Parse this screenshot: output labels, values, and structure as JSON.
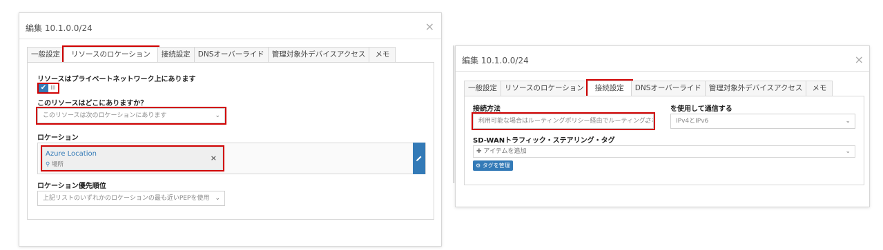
{
  "dialog1": {
    "title": "編集 10.1.0.0/24",
    "close": "×",
    "tabs": [
      "一般設定",
      "リソースのロケーション",
      "接続設定",
      "DNSオーバーライド",
      "管理対象外デバイスアクセス",
      "メモ"
    ],
    "private_label": "リソースはプライベートネットワーク上にあります",
    "toggle_on": "✔",
    "toggle_off": "III",
    "where_label": "このリソースはどこにありますか？",
    "where_value": "このリソースは次のロケーションにあります",
    "location_label": "ロケーション",
    "location_name": "Azure Location",
    "location_sub_icon": "⚲",
    "location_sub": "場所",
    "location_remove": "×",
    "edit_icon": "pencil-icon",
    "priority_label": "ロケーション優先順位",
    "priority_value": "上記リストのいずれかのロケーションの最も近いPEPを使用"
  },
  "dialog2": {
    "title": "編集 10.1.0.0/24",
    "close": "×",
    "tabs": [
      "一般設定",
      "リソースのロケーション",
      "接続設定",
      "DNSオーバーライド",
      "管理対象外デバイスアクセス",
      "メモ"
    ],
    "conn_method_label": "接続方法",
    "conn_method_value": "利用可能な場合はルーティングポリシー経由でルーティングされた I",
    "use_label": "を使用して通信する",
    "use_value": "IPv4とIPv6",
    "sdwan_label": "SD-WANトラフィック・ステアリング・タグ",
    "add_item": "✚ アイテムを追加",
    "manage_tags": "⚙ タグを管理"
  },
  "chevron": "⌄",
  "accent": "#337ab7",
  "highlight": "#d00000"
}
